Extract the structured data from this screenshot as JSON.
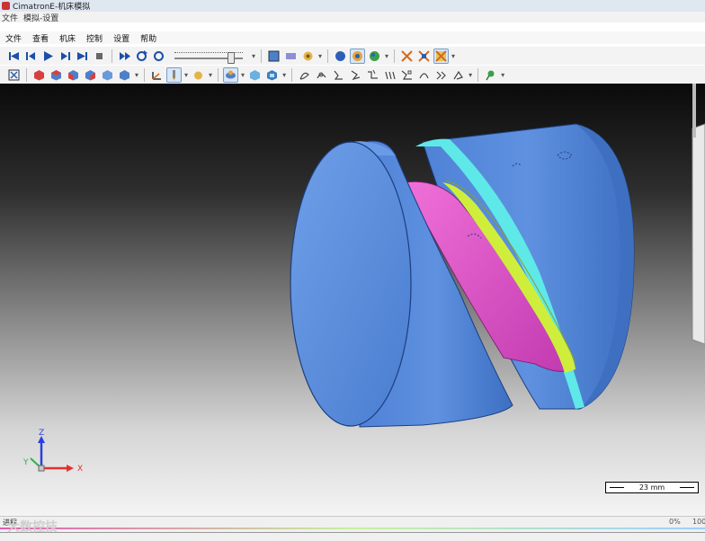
{
  "window": {
    "title": "CimatronE-机床模拟"
  },
  "mini_menu": {
    "file": "文件",
    "path": "模拟-设置"
  },
  "menu": {
    "items": [
      "文件",
      "查看",
      "机床",
      "控制",
      "设置",
      "帮助"
    ]
  },
  "toolbar1": {
    "playback": [
      "skip-to-start-icon",
      "step-back-icon",
      "play-icon",
      "step-forward-icon",
      "skip-to-end-icon",
      "stop-icon"
    ],
    "sim": [
      "fast-forward-icon",
      "cycle-icon",
      "refresh-icon"
    ],
    "view": [
      "shaded-icon",
      "wireframe-icon",
      "tool-view-icon"
    ],
    "display": [
      "sphere-icon",
      "material-icon",
      "globe-icon"
    ],
    "right": [
      "grid-icon-1",
      "grid-icon-2",
      "grid-icon-3"
    ]
  },
  "toolbar2": {
    "views": [
      "fit-icon",
      "cube-front-icon",
      "cube-top-icon",
      "cube-left-icon",
      "cube-right-icon",
      "cube-iso-icon",
      "cube-back-icon"
    ],
    "tools": [
      "axis-icon",
      "tool-icon",
      "hand-icon",
      "light-icon",
      "part-icon"
    ],
    "paths": [
      "path-icon-1",
      "path-icon-2",
      "path-icon-3",
      "path-icon-4",
      "path-icon-5",
      "path-icon-6",
      "path-icon-7",
      "path-icon-8",
      "path-icon-9",
      "path-icon-10"
    ],
    "pin": "pin-icon"
  },
  "slider": {
    "value": 0.85
  },
  "viewport": {
    "triad": {
      "x": "X",
      "y": "Y",
      "z": "Z"
    },
    "colors": {
      "blue": "#5b8fdc",
      "magenta": "#e04fc9",
      "yellow": "#cfee3c",
      "cyan": "#55e6e8",
      "red": "#e23030",
      "green": "#2ab34a"
    }
  },
  "scale_bar": {
    "label": "23 mm"
  },
  "status": {
    "label": "进程",
    "left_pct": "0%",
    "right_pct": "100%"
  },
  "watermark": "大数控技"
}
